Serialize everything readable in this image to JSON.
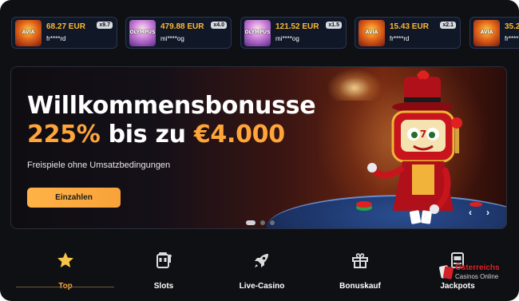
{
  "ticker": {
    "wins": [
      {
        "game_thumb": "Avia Masters",
        "thumb_text": "AVIA",
        "amount": "68.27 EUR",
        "user": "fr****rd",
        "multiplier": "x9.7"
      },
      {
        "game_thumb": "Gates of Olympus",
        "thumb_text": "OLYMPUS",
        "amount": "479.88 EUR",
        "user": "mi****og",
        "multiplier": "x4.0"
      },
      {
        "game_thumb": "Gates of Olympus",
        "thumb_text": "OLYMPUS",
        "amount": "121.52 EUR",
        "user": "mi****og",
        "multiplier": "x1.5"
      },
      {
        "game_thumb": "Avia Masters",
        "thumb_text": "AVIA",
        "amount": "15.43 EUR",
        "user": "fr****rd",
        "multiplier": "x2.1"
      },
      {
        "game_thumb": "Avia Masters",
        "thumb_text": "AVIA",
        "amount": "35.2",
        "user": "fr****",
        "multiplier": ""
      }
    ]
  },
  "hero": {
    "title": "Willkommensbonusse",
    "amount_prefix": "225%",
    "amount_middle": " bis zu ",
    "amount_value": "€4.000",
    "subtitle": "Freispiele ohne Umsatzbedingungen",
    "cta_label": "Einzahlen",
    "slides_total": 3,
    "active_slide": 1,
    "prev_icon": "chevron-left-icon",
    "next_icon": "chevron-right-icon"
  },
  "tabs": [
    {
      "label": "Top",
      "icon": "star-icon",
      "active": true
    },
    {
      "label": "Slots",
      "icon": "slot-machine-icon",
      "active": false
    },
    {
      "label": "Live-Casino",
      "icon": "rocket-icon",
      "active": false
    },
    {
      "label": "Bonuskauf",
      "icon": "gift-icon",
      "active": false
    },
    {
      "label": "Jackpots",
      "icon": "jackpot-machine-icon",
      "active": false
    }
  ],
  "watermark": {
    "title": "Österreichs",
    "subtitle": "Casinos Online"
  },
  "colors": {
    "accent": "#ffa53a",
    "background": "#0f1014",
    "card_bg": "#101828",
    "win_amount": "#ffb830"
  }
}
